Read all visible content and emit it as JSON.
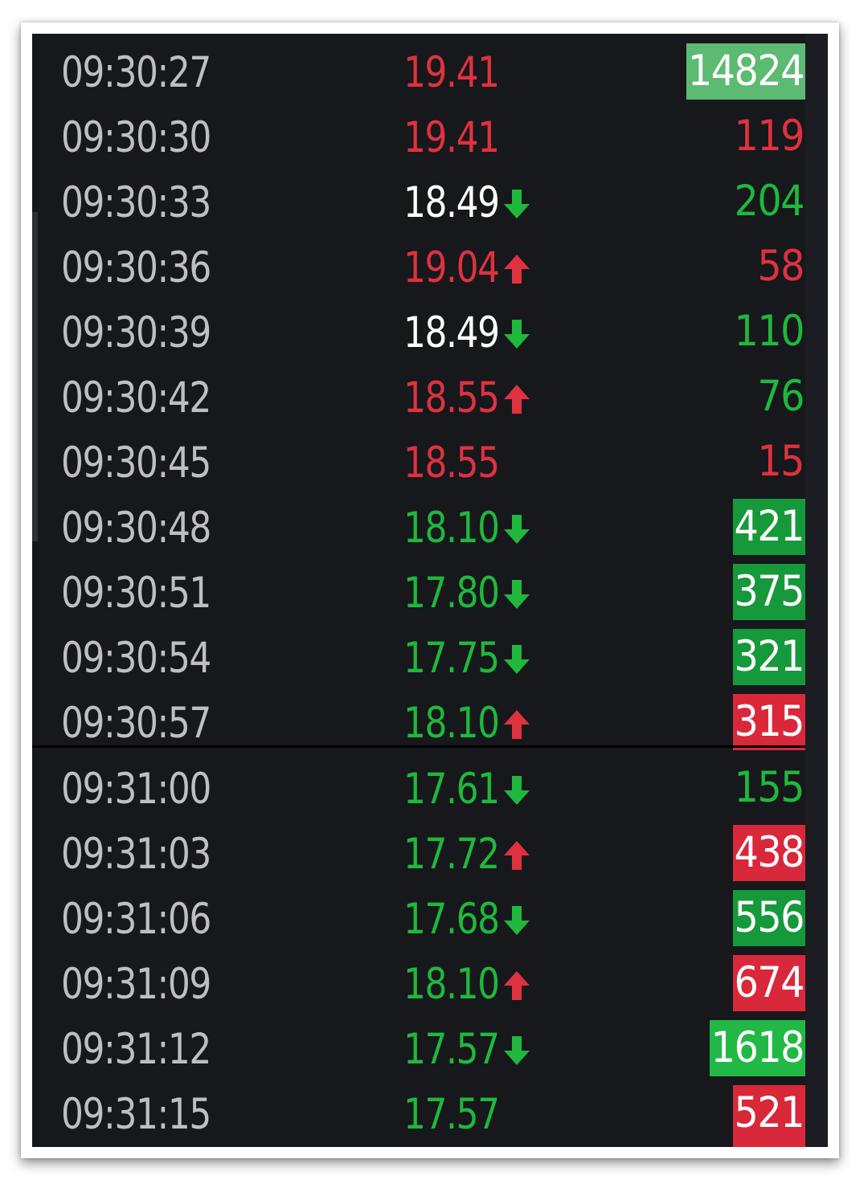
{
  "colors": {
    "background": "#16181c",
    "time_text": "#bfbfbf",
    "up_red": "#e0313f",
    "down_green": "#1fb83c",
    "neutral_white": "#ffffff",
    "vol_box_green": "#15993a",
    "vol_box_red": "#d9283a",
    "vol_box_light_green": "#5cba72",
    "vol_box_bright_green": "#22b845"
  },
  "ticks": [
    {
      "time": "09:30:27",
      "price": "19.41",
      "price_color": "red",
      "arrow": "none",
      "volume": "14824",
      "volume_style": "box-lightgreen"
    },
    {
      "time": "09:30:30",
      "price": "19.41",
      "price_color": "red",
      "arrow": "none",
      "volume": "119",
      "volume_style": "text-red"
    },
    {
      "time": "09:30:33",
      "price": "18.49",
      "price_color": "white",
      "arrow": "down",
      "volume": "204",
      "volume_style": "text-green"
    },
    {
      "time": "09:30:36",
      "price": "19.04",
      "price_color": "red",
      "arrow": "up",
      "volume": "58",
      "volume_style": "text-red"
    },
    {
      "time": "09:30:39",
      "price": "18.49",
      "price_color": "white",
      "arrow": "down",
      "volume": "110",
      "volume_style": "text-green"
    },
    {
      "time": "09:30:42",
      "price": "18.55",
      "price_color": "red",
      "arrow": "up",
      "volume": "76",
      "volume_style": "text-green"
    },
    {
      "time": "09:30:45",
      "price": "18.55",
      "price_color": "red",
      "arrow": "none",
      "volume": "15",
      "volume_style": "text-red"
    },
    {
      "time": "09:30:48",
      "price": "18.10",
      "price_color": "green",
      "arrow": "down",
      "volume": "421",
      "volume_style": "box-green"
    },
    {
      "time": "09:30:51",
      "price": "17.80",
      "price_color": "green",
      "arrow": "down",
      "volume": "375",
      "volume_style": "box-green"
    },
    {
      "time": "09:30:54",
      "price": "17.75",
      "price_color": "green",
      "arrow": "down",
      "volume": "321",
      "volume_style": "box-green"
    },
    {
      "time": "09:30:57",
      "price": "18.10",
      "price_color": "green",
      "arrow": "up",
      "volume": "315",
      "volume_style": "box-red"
    },
    {
      "time": "09:31:00",
      "price": "17.61",
      "price_color": "green",
      "arrow": "down",
      "volume": "155",
      "volume_style": "text-green"
    },
    {
      "time": "09:31:03",
      "price": "17.72",
      "price_color": "green",
      "arrow": "up",
      "volume": "438",
      "volume_style": "box-red"
    },
    {
      "time": "09:31:06",
      "price": "17.68",
      "price_color": "green",
      "arrow": "down",
      "volume": "556",
      "volume_style": "box-green"
    },
    {
      "time": "09:31:09",
      "price": "18.10",
      "price_color": "green",
      "arrow": "up",
      "volume": "674",
      "volume_style": "box-red"
    },
    {
      "time": "09:31:12",
      "price": "17.57",
      "price_color": "green",
      "arrow": "down",
      "volume": "1618",
      "volume_style": "box-brightgreen"
    },
    {
      "time": "09:31:15",
      "price": "17.57",
      "price_color": "green",
      "arrow": "none",
      "volume": "521",
      "volume_style": "box-red"
    }
  ]
}
